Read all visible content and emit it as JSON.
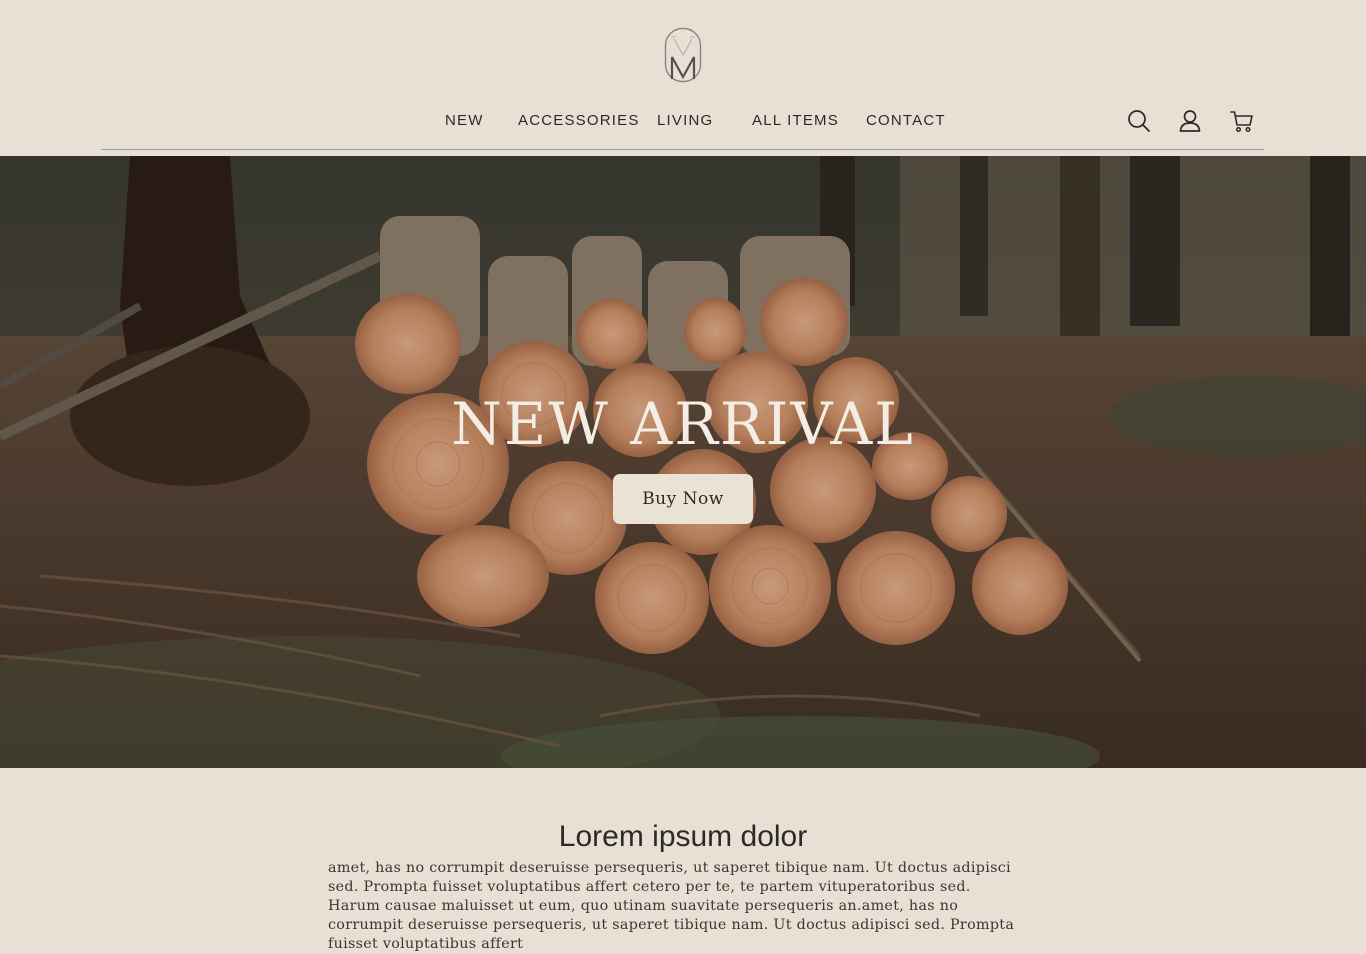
{
  "header": {
    "logo_letter": "M",
    "nav": [
      {
        "label": "NEW"
      },
      {
        "label": "ACCESSORIES"
      },
      {
        "label": "LIVING"
      },
      {
        "label": "ALL ITEMS"
      },
      {
        "label": "CONTACT"
      }
    ],
    "icons": [
      "search-icon",
      "user-icon",
      "cart-icon"
    ]
  },
  "hero": {
    "title": "NEW ARRIVAL",
    "button_label": "Buy Now"
  },
  "content": {
    "title": "Lorem ipsum dolor",
    "paragraph": "amet, has no corrumpit deseruisse persequeris, ut saperet tibique nam. Ut doctus adipisci sed. Prompta fuisset voluptatibus affert cetero per te, te partem vituperatoribus sed. Harum causae maluisset ut eum, quo utinam suavitate persequeris an.amet, has no corrumpit deseruisse persequeris, ut saperet tibique nam. Ut doctus adipisci sed. Prompta fuisset voluptatibus affert"
  },
  "colors": {
    "background": "#e9e0d5",
    "text": "#2d2a26",
    "button_bg": "#ebe2d6",
    "divider": "#9a9da3"
  }
}
